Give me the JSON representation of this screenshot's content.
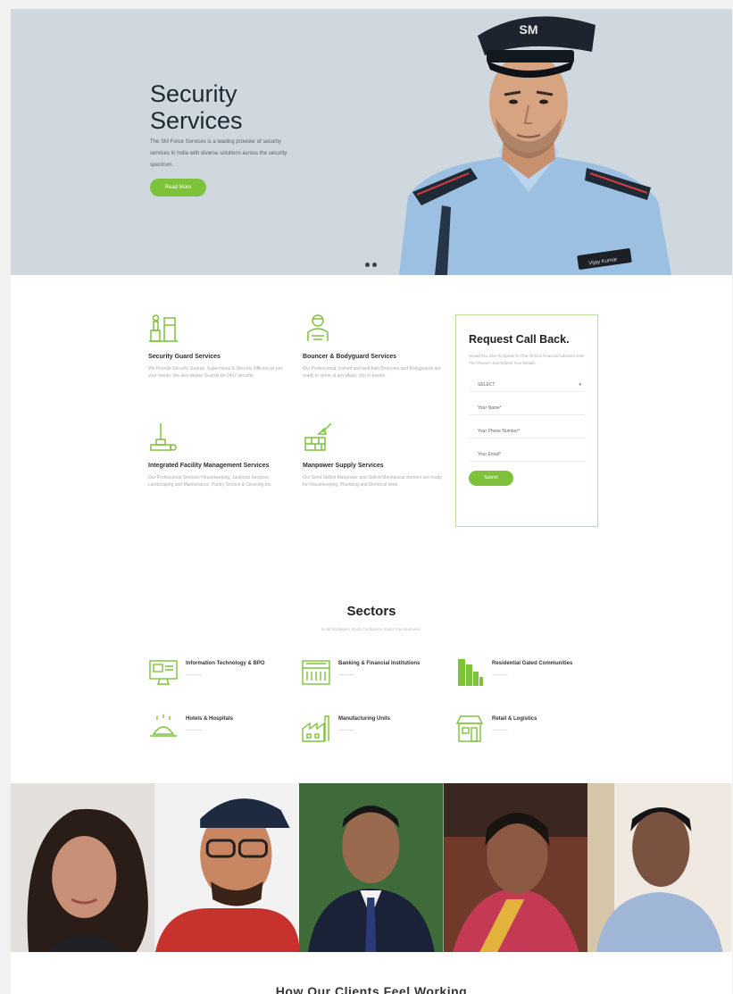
{
  "hero": {
    "title_line1": "Security",
    "title_line2": "Services",
    "description": "The SM Force Services is a leading provider of security services in India with diverse solutions across the security spectrum.",
    "button_label": "Read More",
    "cap_logo": "SM",
    "badge_text": "Vijay Kumar"
  },
  "services": [
    {
      "title": "Security Guard Services",
      "text": "We Provide Security Guards, Supervisors & Security Officers as per your needs. We also deliver Guards for 24x7 security."
    },
    {
      "title": "Bouncer & Bodyguard Services",
      "text": "Our Professional, trained and well-built Bouncers and Bodyguards are ready to serve at any place, city or events."
    },
    {
      "title": "Integrated Facility Management Services",
      "text": "Our Professional Services Housekeeping, Janitorial Services, Landscaping and Maintenance, Pantry Service & Cleaning etc."
    },
    {
      "title": "Manpower Supply Services",
      "text": "Our Semi Skilled Manpower and Skilled Mechanical workers are ready for Housekeeping, Plumbing and Electrical work."
    }
  ],
  "callback": {
    "title": "Request Call Back.",
    "text": "Would You Like To Speak To One Of Our Financial Advisers Over The Phone? Just Submit Your Details.",
    "select_value": "SELECT",
    "name_placeholder": "Your Name*",
    "phone_placeholder": "Your Phone Number*",
    "email_placeholder": "Your Email*",
    "submit_label": "Submit"
  },
  "sectors": {
    "title": "Sectors",
    "subtitle": "Build Strategies, Build Confidence, Build Your Business.",
    "items": [
      {
        "name": "Information Technology & BPO"
      },
      {
        "name": "Banking & Financial Institutions"
      },
      {
        "name": "Residential Gated Communities"
      },
      {
        "name": "Hotels & Hospitals"
      },
      {
        "name": "Manufacturing Units"
      },
      {
        "name": "Retail & Logistics"
      }
    ]
  },
  "bottom_heading": "How Our Clients Feel Working",
  "colors": {
    "accent": "#7dc23a",
    "hero_bg": "#cfd8de",
    "border": "#bfe09a"
  }
}
